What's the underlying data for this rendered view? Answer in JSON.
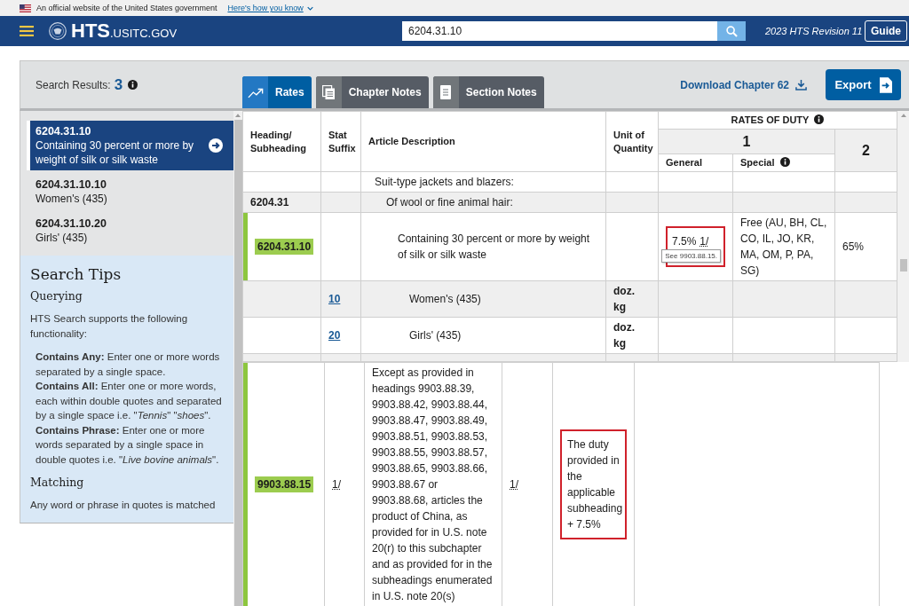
{
  "gov_banner": {
    "text": "An official website of the United States government",
    "link": "Here's how you know"
  },
  "header": {
    "logo": {
      "name": "HTS",
      "domain": ".USITC.GOV"
    },
    "search": {
      "value": "6204.31.10"
    },
    "revision": "2023 HTS Revision 11",
    "guide_button": "Guide"
  },
  "search_results": {
    "label": "Search Results:",
    "count": "3",
    "info": true,
    "items": [
      {
        "code": "6204.31.10",
        "description": "Containing 30 percent or more by weight of silk or silk waste",
        "selected": true
      },
      {
        "code": "6204.31.10.10",
        "description": "Women's (435)",
        "selected": false
      },
      {
        "code": "6204.31.10.20",
        "description": "Girls' (435)",
        "selected": false
      }
    ]
  },
  "search_tips": {
    "title": "Search Tips",
    "sections": [
      {
        "heading": "Querying",
        "text": "HTS Search supports the following functionality:",
        "tips": [
          "**Contains Any:** Enter one or more words separated by a single space.",
          "**Contains All:** Enter one or more words, each within double quotes and separated by a single space i.e. \"*Tennis*\" \"*shoes*\".",
          "**Contains Phrase:** Enter one or more words separated by a single space in double quotes i.e. \"*Live bovine animals*\"."
        ]
      },
      {
        "heading": "Matching",
        "text": "Any word or phrase in quotes is matched"
      }
    ]
  },
  "tabs": [
    {
      "label": "Rates",
      "selected": true
    },
    {
      "label": "Chapter Notes",
      "selected": false
    },
    {
      "label": "Section Notes",
      "selected": false
    }
  ],
  "download_link": "Download Chapter 62",
  "export_button": "Export",
  "table": {
    "columns": [
      "Heading/ Subheading",
      "Stat Suffix",
      "Article Description",
      "Unit of Quantity"
    ],
    "rates_of_duty": {
      "label": "RATES OF DUTY",
      "info": true
    },
    "rate_columns": [
      {
        "label": "1",
        "sub_columns": [
          {
            "label": "General",
            "info": false
          },
          {
            "label": "Special",
            "info": true
          }
        ]
      },
      {
        "label": "2"
      }
    ],
    "rows": [
      {
        "description": "Suit-type jackets and blazers:",
        "matched": false,
        "children": [
          {
            "heading": "6204.31",
            "description": "Of wool or fine animal hair:",
            "matched": false,
            "children": [
              {
                "heading": "6204.31.10",
                "description": "Containing 30 percent or more by weight of silk or silk waste",
                "matched": true,
                "general": {
                  "text": "7.5%",
                  "footnote": "1/",
                  "tooltip": "See 9903.88.15.",
                  "annotated": true
                },
                "special": "Free (AU, BH, CL, CO, IL, JO, KR, MA, OM, P, PA, SG)",
                "column_2": "65%",
                "children": [
                  {
                    "stat_suffix": "10",
                    "description": "Women's (435)",
                    "unit": [
                      "doz.",
                      "kg"
                    ],
                    "matched": false
                  },
                  {
                    "stat_suffix": "20",
                    "description": "Girls' (435)",
                    "unit": [
                      "doz.",
                      "kg"
                    ],
                    "matched": false
                  }
                ]
              }
            ]
          }
        ]
      }
    ]
  },
  "footnote_table": {
    "rows": [
      {
        "heading": "9903.88.15",
        "matched": true,
        "stat_suffix": "1/",
        "description": "Except as provided in headings 9903.88.39, 9903.88.42, 9903.88.44, 9903.88.47, 9903.88.49, 9903.88.51, 9903.88.53, 9903.88.55, 9903.88.57, 9903.88.65, 9903.88.66, 9903.88.67 or 9903.88.68, articles the product of China, as provided for in U.S. note 20(r) to this subchapter and as provided for in the subheadings enumerated in U.S. note 20(s)",
        "unit": "1/",
        "general": {
          "text": "The duty provided in the applicable subheading + 7.5%",
          "annotated": true
        }
      }
    ]
  }
}
